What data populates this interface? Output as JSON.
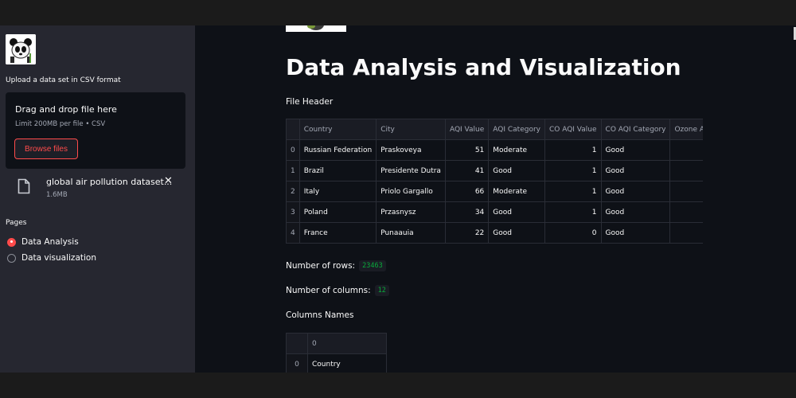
{
  "sidebar": {
    "upload_label": "Upload a data set in CSV format",
    "dropzone": {
      "title": "Drag and drop file here",
      "limit": "Limit 200MB per file • CSV",
      "browse_label": "Browse files"
    },
    "file": {
      "name": "global air pollution dataset...",
      "size": "1.6MB",
      "close": "✕"
    },
    "pages_label": "Pages",
    "pages": [
      {
        "label": "Data Analysis",
        "selected": true
      },
      {
        "label": "Data visualization",
        "selected": false
      }
    ]
  },
  "main": {
    "title": "Data Analysis and Visualization",
    "file_header_label": "File Header",
    "table": {
      "columns": [
        "",
        "Country",
        "City",
        "AQI Value",
        "AQI Category",
        "CO AQI Value",
        "CO AQI Category",
        "Ozone A"
      ],
      "rows": [
        [
          "0",
          "Russian Federation",
          "Praskoveya",
          "51",
          "Moderate",
          "1",
          "Good",
          ""
        ],
        [
          "1",
          "Brazil",
          "Presidente Dutra",
          "41",
          "Good",
          "1",
          "Good",
          ""
        ],
        [
          "2",
          "Italy",
          "Priolo Gargallo",
          "66",
          "Moderate",
          "1",
          "Good",
          ""
        ],
        [
          "3",
          "Poland",
          "Przasnysz",
          "34",
          "Good",
          "1",
          "Good",
          ""
        ],
        [
          "4",
          "France",
          "Punaauia",
          "22",
          "Good",
          "0",
          "Good",
          ""
        ]
      ]
    },
    "rows_label": "Number of rows:",
    "rows_value": "23463",
    "cols_label": "Number of columns:",
    "cols_value": "12",
    "column_names_label": "Columns Names",
    "column_names_table": {
      "header": [
        "",
        "0"
      ],
      "rows": [
        [
          "0",
          "Country"
        ]
      ]
    }
  },
  "colors": {
    "accent": "#ff4b4b",
    "sidebar_bg": "#262730",
    "main_bg": "#0e1117",
    "code_green": "#09ab3b"
  }
}
